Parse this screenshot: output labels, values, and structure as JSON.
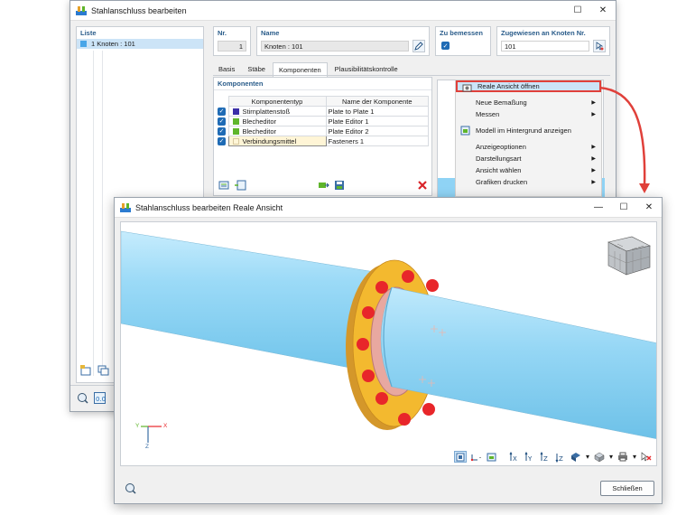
{
  "main_window": {
    "title": "Stahlanschluss bearbeiten",
    "list": {
      "header": "Liste",
      "items": [
        {
          "label": "1  Knoten : 101"
        }
      ]
    },
    "fields": {
      "nr_label": "Nr.",
      "nr_value": "1",
      "name_label": "Name",
      "name_value": "Knoten : 101",
      "zu_bemessen_label": "Zu bemessen",
      "zugewiesen_label": "Zugewiesen an Knoten Nr.",
      "zugewiesen_value": "101"
    },
    "tabs": [
      {
        "label": "Basis"
      },
      {
        "label": "Stäbe"
      },
      {
        "label": "Komponenten"
      },
      {
        "label": "Plausibilitätskontrolle"
      }
    ],
    "components": {
      "header": "Komponenten",
      "col_type": "Komponententyp",
      "col_name": "Name der Komponente",
      "rows": [
        {
          "type": "Stirnplattenstoß",
          "name": "Plate to Plate 1",
          "color": "#3b2fa8"
        },
        {
          "type": "Blecheditor",
          "name": "Plate Editor 1",
          "color": "#5fb52b"
        },
        {
          "type": "Blecheditor",
          "name": "Plate Editor 2",
          "color": "#5fb52b"
        },
        {
          "type": "Verbindungsmittel",
          "name": "Fasteners 1",
          "color": "#fff5d6"
        }
      ]
    },
    "context_menu": {
      "items": [
        {
          "label": "Reale Ansicht öffnen",
          "icon": "real-view-icon"
        },
        {
          "label": "Neue Bemaßung",
          "submenu": true
        },
        {
          "label": "Messen",
          "submenu": true
        },
        {
          "label": "Modell im Hintergrund anzeigen",
          "icon": "model-background-icon"
        },
        {
          "label": "Anzeigeoptionen",
          "submenu": true
        },
        {
          "label": "Darstellungsart",
          "submenu": true
        },
        {
          "label": "Ansicht wählen",
          "submenu": true
        },
        {
          "label": "Grafiken drucken",
          "submenu": true
        }
      ]
    }
  },
  "real_view_window": {
    "title": "Stahlanschluss bearbeiten Reale Ansicht",
    "axes": {
      "x": "X",
      "y": "Y",
      "z": "Z"
    },
    "close_button": "Schließen"
  },
  "colors": {
    "accent": "#1f6bb5",
    "highlight_border": "#e0403a",
    "pipe": "#8fd3f5",
    "flange": "#f3b92f",
    "bolt": "#e8262a"
  }
}
